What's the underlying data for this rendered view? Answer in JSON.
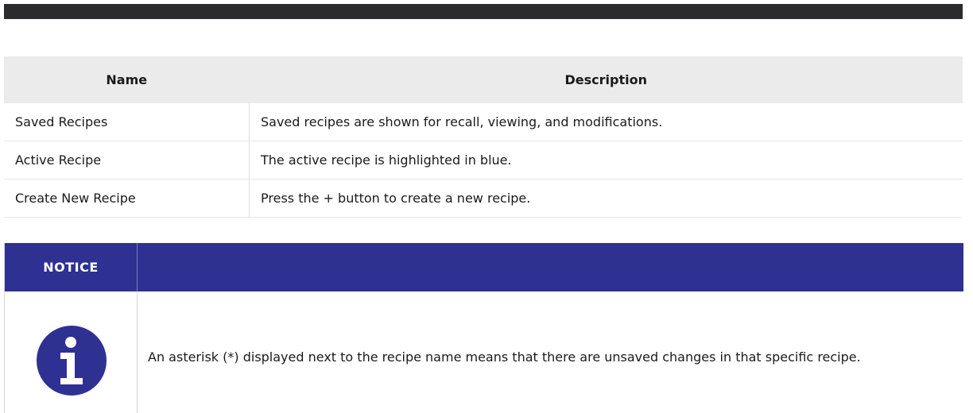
{
  "table": {
    "headers": {
      "name": "Name",
      "description": "Description"
    },
    "rows": [
      {
        "name": "Saved Recipes",
        "description": "Saved recipes are shown for recall, viewing, and modifications."
      },
      {
        "name": "Active Recipe",
        "description": "The active recipe is highlighted in blue."
      },
      {
        "name": "Create New Recipe",
        "description": "Press the + button to create a new recipe."
      }
    ]
  },
  "notice": {
    "label": "NOTICE",
    "icon": "info-icon",
    "text": "An asterisk (*) displayed next to the recipe name means that there are unsaved changes in that specific recipe.",
    "color": "#2e3191"
  }
}
